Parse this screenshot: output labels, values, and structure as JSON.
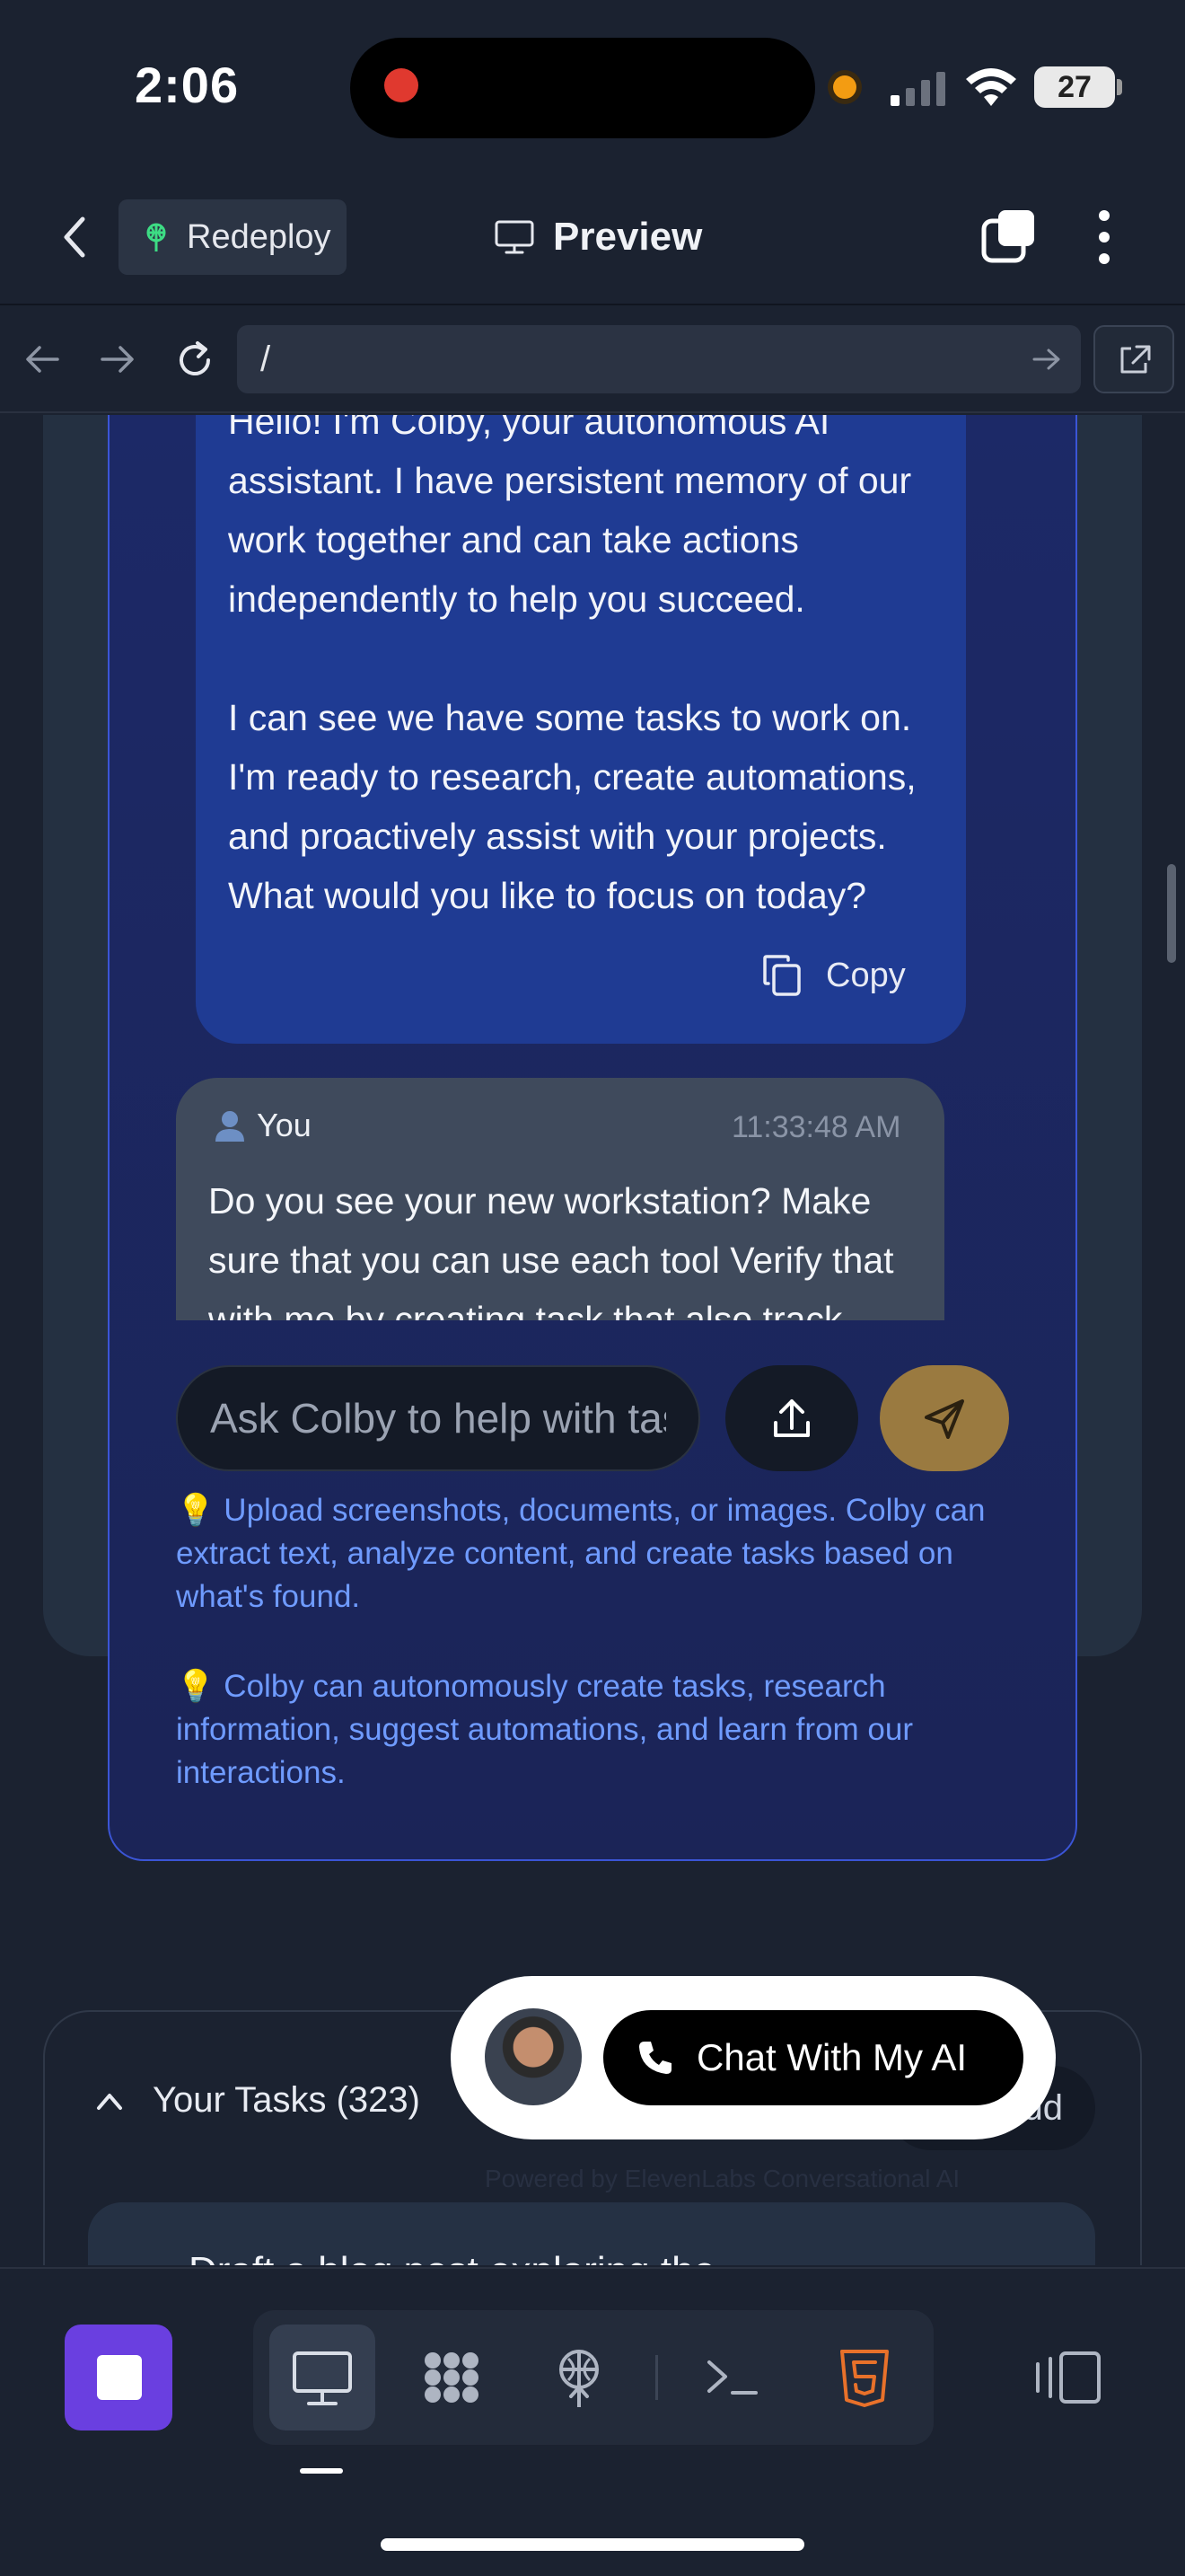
{
  "status_bar": {
    "time": "2:06",
    "battery": "27"
  },
  "header": {
    "redeploy_label": "Redeploy",
    "title": "Preview"
  },
  "browser": {
    "url": "/"
  },
  "chat": {
    "assistant_message": "Hello! I'm Colby, your autonomous AI assistant. I have persistent memory of our work together and can take actions independently to help you succeed.\n\nI can see we have some tasks to work on. I'm ready to research, create automations, and proactively assist with your projects. What would you like to focus on today?",
    "copy_label": "Copy",
    "user_label": "You",
    "user_time": "11:33:48 AM",
    "user_message": "Do you see your new workstation? Make sure that you can use each tool Verify that with me by creating task that also track",
    "input_placeholder": "Ask Colby to help with tasks...",
    "tip_upload": "💡 Upload screenshots, documents, or images. Colby can extract text, analyze content, and create tasks based on what's found.",
    "tip_autonomous": "💡 Colby can autonomously create tasks, research information, suggest automations, and learn from our interactions."
  },
  "tasks": {
    "title": "Your Tasks (323)",
    "add_label": "Add",
    "first_task": "Draft a blog post exploring the"
  },
  "widget": {
    "cta_label": "Chat With My AI",
    "powered_by": "Powered by ElevenLabs Conversational AI"
  },
  "colors": {
    "accent_purple": "#6a3fe0",
    "panel_border": "#3b55d6",
    "assistant_bubble": "#1f3b93",
    "send_button": "#9a7a40",
    "tip_text": "#6f9bff",
    "html5_orange": "#e8712a"
  },
  "icons": {
    "back": "chevron-left-icon",
    "redeploy": "antenna-icon",
    "preview": "monitor-icon",
    "tabs": "tabs-icon",
    "more": "vertical-dots-icon",
    "nav_back": "arrow-left-icon",
    "nav_forward": "arrow-right-icon",
    "reload": "reload-icon",
    "go": "arrow-right-icon",
    "open_external": "external-link-icon",
    "copy": "copy-icon",
    "user": "user-icon",
    "upload": "upload-icon",
    "send": "send-icon",
    "collapse": "chevron-up-icon",
    "phone": "phone-icon",
    "stop": "stop-icon",
    "toolbar": [
      "monitor-icon",
      "grid-icon",
      "antenna-icon",
      "terminal-icon",
      "html5-icon",
      "panels-icon"
    ]
  }
}
